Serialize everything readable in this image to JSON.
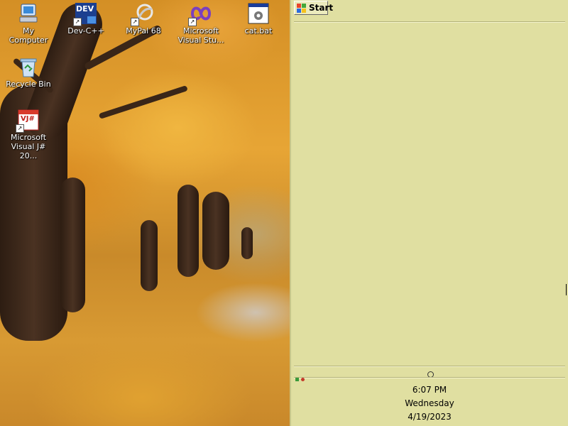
{
  "desktop": {
    "icons": [
      {
        "label": "My Computer",
        "icon": "my-computer-icon"
      },
      {
        "label": "Dev-C++",
        "icon": "dev-cpp-icon",
        "badge": "DEV"
      },
      {
        "label": "MyPal 68",
        "icon": "mypal-icon"
      },
      {
        "label": "Microsoft\nVisual Stu...",
        "icon": "visual-studio-icon"
      },
      {
        "label": "cat.bat",
        "icon": "batch-file-icon"
      },
      {
        "label": "Recycle Bin",
        "icon": "recycle-bin-icon"
      },
      {
        "label": "Microsoft\nVisual J# 20...",
        "icon": "visual-jsharp-icon",
        "badge": "VJ#"
      }
    ]
  },
  "taskbar": {
    "start_label": "Start",
    "clock": {
      "time": "6:07 PM",
      "day": "Wednesday",
      "date": "4/19/2023"
    }
  },
  "colors": {
    "taskbar_bg": "#e0dfa1",
    "desktop_text": "#ffffff"
  }
}
